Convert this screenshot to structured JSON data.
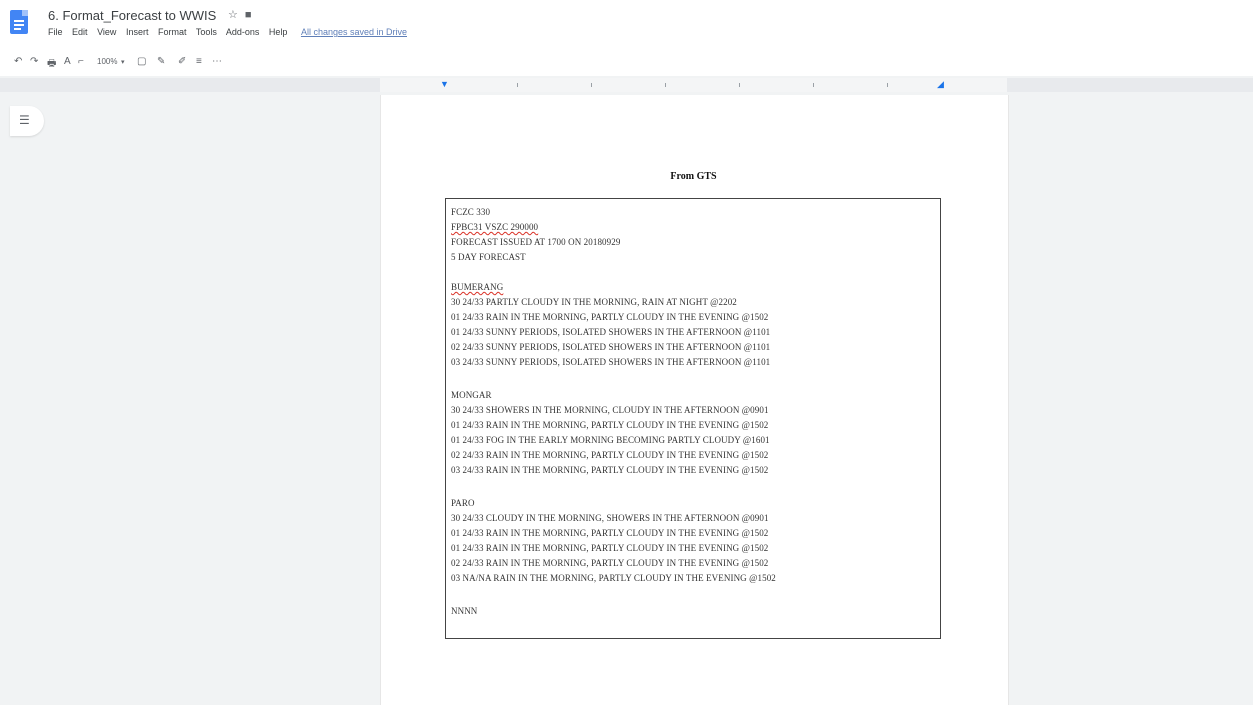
{
  "document": {
    "title": "6. Format_Forecast to WWIS",
    "title_icons": "☆ ■",
    "heading": "From GTS"
  },
  "menu": [
    "File",
    "Edit",
    "View",
    "Insert",
    "Format",
    "Tools",
    "Add-ons",
    "Help"
  ],
  "last_edit": "All changes saved in Drive",
  "toolbar": {
    "zoom": "100%",
    "icons": [
      "undo-icon",
      "redo-icon",
      "print-icon",
      "spellcheck-icon",
      "paint-format-icon",
      "zoom-select",
      "image-icon",
      "pen-icon",
      "highlight-icon",
      "line-spacing-icon",
      "more-icon"
    ]
  },
  "forecast": {
    "header_lines": [
      "FCZC 330",
      "FPBC31 VSZC 290000",
      "FORECAST ISSUED AT 1700 ON 20180929",
      "5 DAY FORECAST"
    ],
    "cities": [
      {
        "name": "BUMERANG",
        "rows": [
          "30  24/33  PARTLY CLOUDY IN THE MORNING, RAIN AT NIGHT @2202",
          "01  24/33  RAIN IN THE MORNING, PARTLY CLOUDY IN THE EVENING @1502",
          "01  24/33  SUNNY PERIODS, ISOLATED SHOWERS IN THE AFTERNOON @1101",
          "02  24/33  SUNNY PERIODS, ISOLATED SHOWERS IN THE AFTERNOON @1101",
          "03  24/33  SUNNY PERIODS, ISOLATED SHOWERS IN THE AFTERNOON @1101"
        ]
      },
      {
        "name": "MONGAR",
        "rows": [
          "30  24/33  SHOWERS IN THE MORNING, CLOUDY IN THE AFTERNOON @0901",
          "01  24/33  RAIN IN THE MORNING, PARTLY CLOUDY IN THE EVENING @1502",
          "01  24/33  FOG IN THE EARLY MORNING BECOMING PARTLY CLOUDY @1601",
          "02  24/33  RAIN IN THE MORNING, PARTLY CLOUDY IN THE EVENING @1502",
          "03  24/33  RAIN IN THE MORNING, PARTLY CLOUDY IN THE EVENING @1502"
        ]
      },
      {
        "name": "PARO",
        "rows": [
          "30  24/33  CLOUDY IN THE MORNING, SHOWERS IN THE AFTERNOON @0901",
          "01  24/33  RAIN IN THE MORNING, PARTLY CLOUDY IN THE EVENING @1502",
          "01  24/33  RAIN IN THE MORNING, PARTLY CLOUDY IN THE EVENING @1502",
          "02  24/33  RAIN IN THE MORNING, PARTLY CLOUDY IN THE EVENING @1502",
          "03  NA/NA  RAIN IN THE MORNING, PARTLY CLOUDY IN THE EVENING @1502"
        ]
      }
    ],
    "footer": "NNNN"
  }
}
